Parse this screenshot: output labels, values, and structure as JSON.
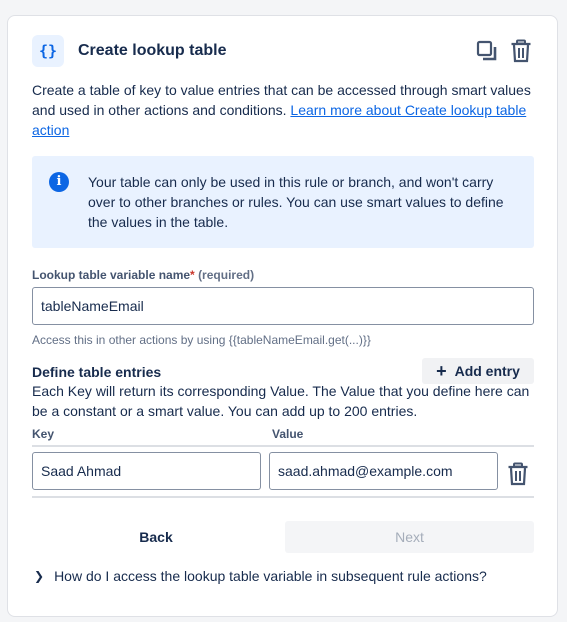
{
  "header": {
    "icon_glyph": "{}",
    "icon_name": "curly-braces-icon",
    "title": "Create lookup table",
    "copy_icon": "copy-icon",
    "delete_icon": "trash-icon"
  },
  "description": {
    "text": "Create a table of key to value entries that can be accessed through smart values and used in other actions and conditions. ",
    "link_text": "Learn more about Create lookup table action"
  },
  "info_panel": {
    "icon": "info-icon",
    "text": "Your table can only be used in this rule or branch, and won't carry over to other branches or rules. You can use smart values to define the values in the table."
  },
  "variable_name": {
    "label": "Lookup table variable name",
    "required_marker": "*",
    "required_text": "(required)",
    "value": "tableNameEmail",
    "helper": "Access this in other actions by using {{tableNameEmail.get(...)}}"
  },
  "table_entries": {
    "title": "Define table entries",
    "add_button_label": "Add entry",
    "description": "Each Key will return its corresponding Value. The Value that you define here can be a constant or a smart value. You can add up to 200 entries.",
    "columns": {
      "key": "Key",
      "value": "Value"
    },
    "rows": [
      {
        "key": "Saad Ahmad",
        "value": "saad.ahmad@example.com"
      }
    ]
  },
  "footer": {
    "back_label": "Back",
    "next_label": "Next",
    "faq_text": "How do I access the lookup table variable in subsequent rule actions?"
  },
  "colors": {
    "accent": "#0c66e4",
    "info_bg": "#e9f2ff",
    "required": "#c9372c"
  }
}
